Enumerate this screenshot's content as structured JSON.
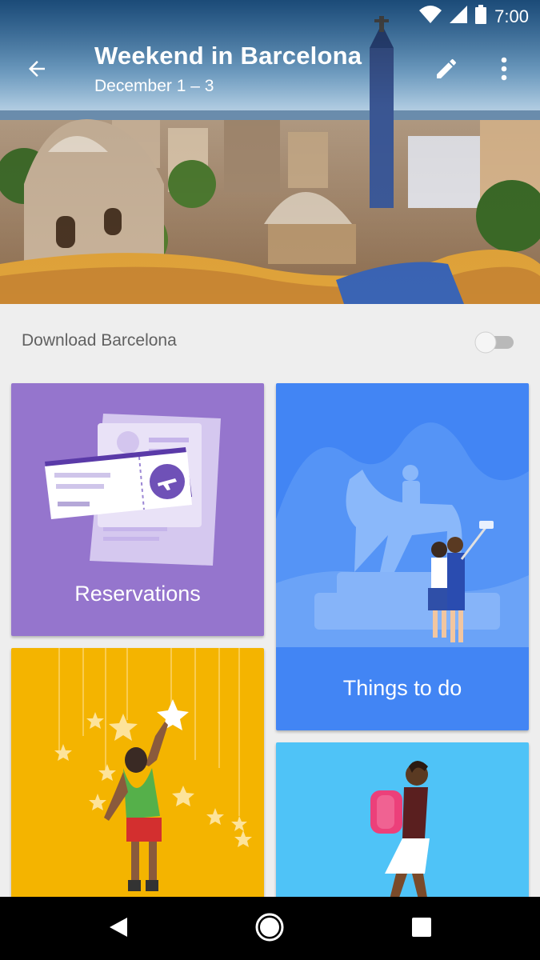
{
  "status_bar": {
    "time": "7:00"
  },
  "header": {
    "title": "Weekend in Barcelona",
    "subtitle": "December 1 – 3"
  },
  "download": {
    "label": "Download Barcelona",
    "enabled": false
  },
  "cards": [
    {
      "label": "Reservations",
      "color": "#9575cd"
    },
    {
      "label": "Things to do",
      "color": "#4285f4"
    },
    {
      "label": "",
      "color": "#f4b400"
    },
    {
      "label": "",
      "color": "#4fc3f7"
    }
  ],
  "icons": {
    "back": "arrow-back-icon",
    "edit": "pencil-icon",
    "more": "more-vert-icon",
    "wifi": "wifi-icon",
    "signal": "signal-icon",
    "battery": "battery-icon",
    "nav_back": "nav-back-icon",
    "nav_home": "nav-home-icon",
    "nav_recents": "nav-recents-icon"
  }
}
